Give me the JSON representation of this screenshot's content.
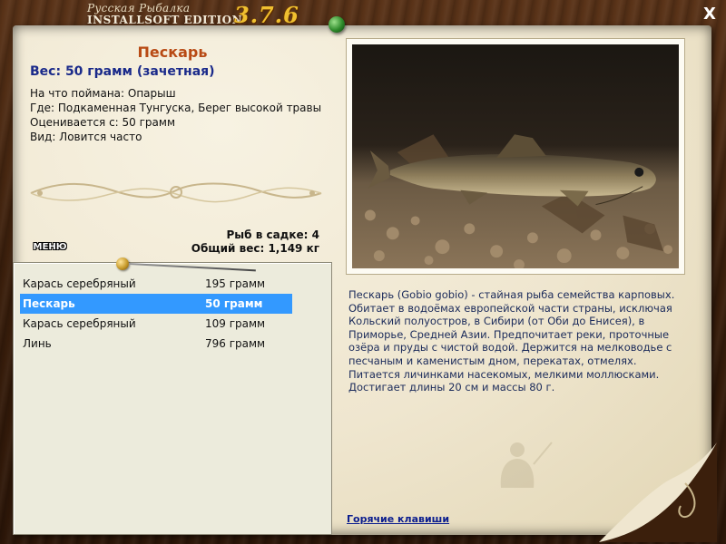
{
  "app": {
    "brand_top": "Русская Рыбалка",
    "brand_bottom": "INSTALLSOFT EDITION",
    "version": "3.7.6",
    "close_label": "X"
  },
  "fish": {
    "name": "Пескарь",
    "weight_line": "Вес: 50 грамм (зачетная)",
    "caught_on": "На что поймана: Опарыш",
    "where": "Где: Подкаменная Тунгуска, Берег высокой травы",
    "valued_from": "Оценивается с: 50 грамм",
    "kind": "Вид: Ловится часто"
  },
  "stats": {
    "fish_in_net": "Рыб в садке: 4",
    "total_weight": "Общий вес: 1,149 кг"
  },
  "menu": {
    "label": "МЕНЮ"
  },
  "catch_list": [
    {
      "name": "Карась серебряный",
      "weight": "195 грамм",
      "selected": false
    },
    {
      "name": "Пескарь",
      "weight": "50 грамм",
      "selected": true
    },
    {
      "name": "Карась серебряный",
      "weight": "109 грамм",
      "selected": false
    },
    {
      "name": "Линь",
      "weight": "796 грамм",
      "selected": false
    }
  ],
  "description": "Пескарь (Gobio gobio) - стайная рыба семейства карповых. Обитает в водоёмах европейской части страны, исключая Кольский полуостров, в Сибири (от Оби до Енисея), в Приморье, Средней Азии. Предпочитает реки, проточные озёра и пруды с чистой водой. Держится на мелководье с песчаным и каменистым дном, перекатах, отмелях. Питается личинками насекомых, мелкими моллюсками. Достигает длины 20 см и массы 80 г.",
  "footer": {
    "hotkeys_label": "Горячие клавиши"
  },
  "colors": {
    "fish_name": "#b84a14",
    "weight_line": "#1a2a8a",
    "selection": "#3399ff",
    "version": "#f0c030",
    "link": "#0b1d8e"
  }
}
